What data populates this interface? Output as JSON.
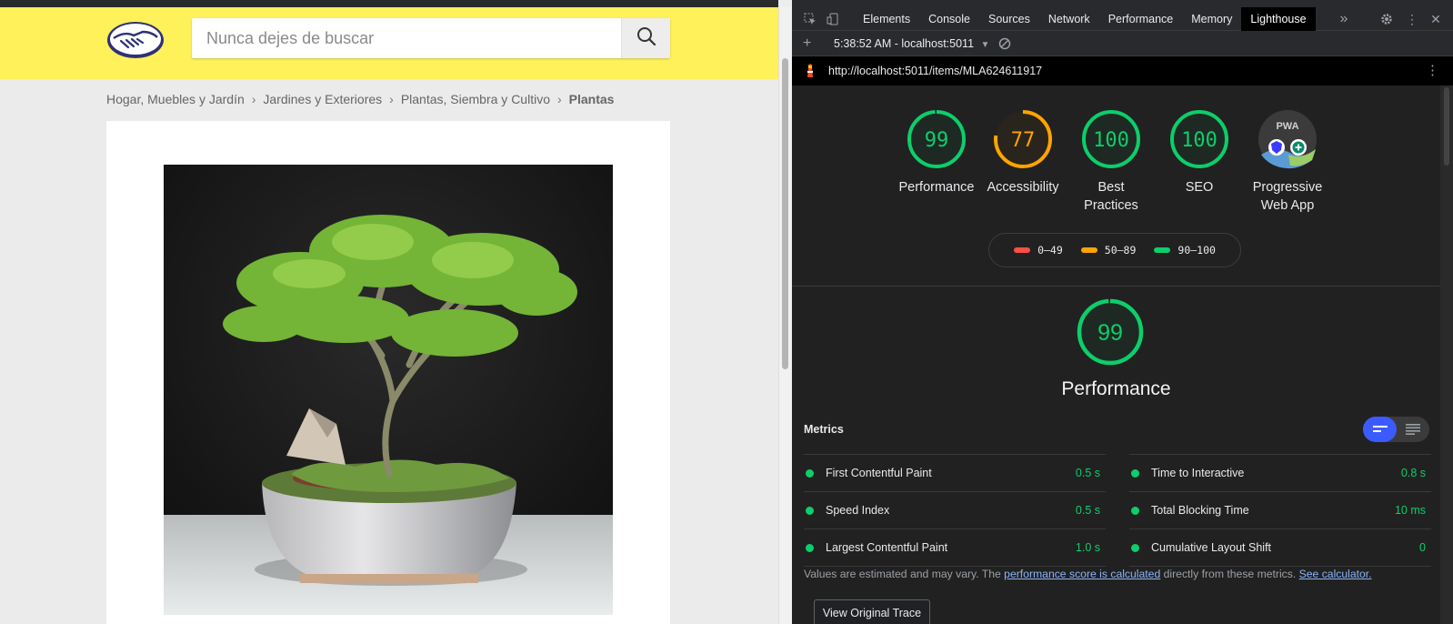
{
  "page": {
    "search": {
      "placeholder": "Nunca dejes de buscar"
    },
    "breadcrumb": [
      "Hogar, Muebles y Jardín",
      "Jardines y Exteriores",
      "Plantas, Siembra y Cultivo",
      "Plantas"
    ],
    "brand_colors": {
      "header": "#fff159",
      "logo": "#2d3277"
    }
  },
  "devtools": {
    "tabs": [
      "Elements",
      "Console",
      "Sources",
      "Network",
      "Performance",
      "Memory",
      "Lighthouse"
    ],
    "active_tab": "Lighthouse",
    "report_selector": "5:38:52 AM - localhost:5011",
    "url": "http://localhost:5011/items/MLA624611917",
    "scores": [
      {
        "score": 99,
        "label": "Performance",
        "color": "#0cce6b"
      },
      {
        "score": 77,
        "label": "Accessibility",
        "color": "#ffa400"
      },
      {
        "score": 100,
        "label": "Best Practices",
        "color": "#0cce6b"
      },
      {
        "score": 100,
        "label": "SEO",
        "color": "#0cce6b"
      }
    ],
    "pwa": {
      "label": "Progressive Web App",
      "badge": "PWA"
    },
    "legend": [
      {
        "range": "0–49",
        "color": "#ff4e42"
      },
      {
        "range": "50–89",
        "color": "#ffa400"
      },
      {
        "range": "90–100",
        "color": "#0cce6b"
      }
    ],
    "performance": {
      "score": 99,
      "title": "Performance"
    },
    "metrics_heading": "Metrics",
    "metrics": [
      {
        "name": "First Contentful Paint",
        "value": "0.5 s"
      },
      {
        "name": "Time to Interactive",
        "value": "0.8 s"
      },
      {
        "name": "Speed Index",
        "value": "0.5 s"
      },
      {
        "name": "Total Blocking Time",
        "value": "10 ms"
      },
      {
        "name": "Largest Contentful Paint",
        "value": "1.0 s"
      },
      {
        "name": "Cumulative Layout Shift",
        "value": "0"
      }
    ],
    "note": {
      "prefix": "Values are estimated and may vary. The ",
      "link": "performance score is calculated",
      "middle": " directly from these metrics. ",
      "calculator": "See calculator."
    },
    "trace_button": "View Original Trace"
  }
}
